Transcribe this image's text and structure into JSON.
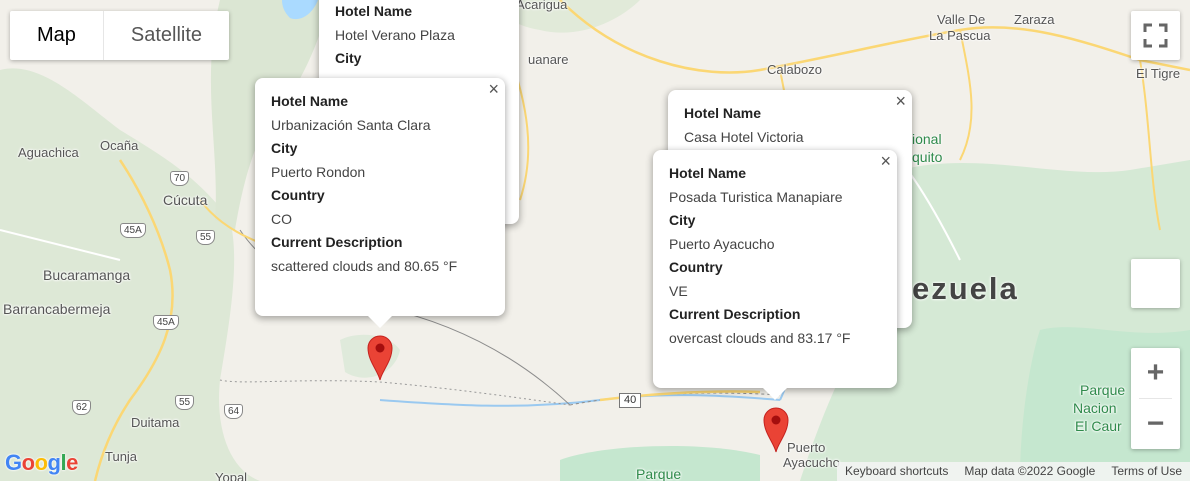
{
  "map_type": {
    "map": "Map",
    "satellite": "Satellite"
  },
  "places": {
    "acarigua": "Acarigua",
    "guanare": "uanare",
    "calabozo": "Calabozo",
    "valle": "Valle De",
    "pascua": "La Pascua",
    "zaraza": "Zaraza",
    "tigre": "El Tigre",
    "aguachica": "Aguachica",
    "ocana": "Ocaña",
    "cucuta": "Cúcuta",
    "bucaramanga": "Bucaramanga",
    "barrancabermeja": "Barrancabermeja",
    "duitama": "Duitama",
    "tunja": "Tunja",
    "yopal": "Yopal",
    "puerto1": "Puerto",
    "ayacucho": "Ayacucho",
    "parque": "Parque",
    "national1": "ional",
    "national2": "quito",
    "parque2": "Parque",
    "nacional": "Nacion",
    "elcau": "El Caur"
  },
  "country": "ezuela",
  "shields": {
    "s70": "70",
    "s45a": "45A",
    "s55": "55",
    "s45a2": "45A",
    "s62": "62",
    "s55b": "55",
    "s64": "64",
    "r40": "40"
  },
  "infowindows": [
    {
      "hotel_label": "Hotel Name",
      "hotel": "Hotel Verano Plaza",
      "city_label": "City"
    },
    {
      "hotel_label": "Hotel Name",
      "hotel": "Urbanización Santa Clara",
      "city_label": "City",
      "city": "Puerto Rondon",
      "country_label": "Country",
      "country": "CO",
      "desc_label": "Current Description",
      "desc": "scattered clouds and 80.65 °F"
    },
    {
      "hotel_label": "Hotel Name",
      "hotel": "Casa Hotel Victoria"
    },
    {
      "hotel_label": "Hotel Name",
      "hotel": "Posada Turistica Manapiare",
      "city_label": "City",
      "city": "Puerto Ayacucho",
      "country_label": "Country",
      "country": "VE",
      "desc_label": "Current Description",
      "desc": "overcast clouds and 83.17 °F"
    }
  ],
  "close_glyph": "×",
  "zoom": {
    "in": "+",
    "out": "−"
  },
  "logo": "Google",
  "attribution": {
    "shortcuts": "Keyboard shortcuts",
    "data": "Map data ©2022 Google",
    "terms": "Terms of Use"
  },
  "colors": {
    "marker": "#ea4335",
    "marker_dark": "#a50e0e",
    "park_green": "#c5e7cf",
    "road_yellow": "#fbd774"
  }
}
